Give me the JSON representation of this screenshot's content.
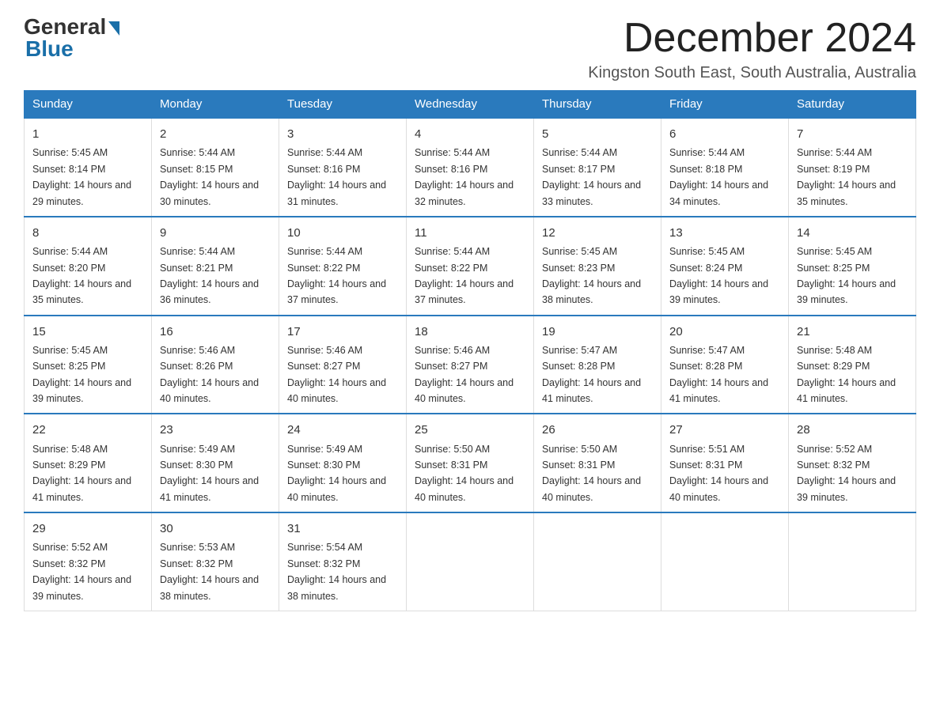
{
  "header": {
    "logo_general": "General",
    "logo_blue": "Blue",
    "month_title": "December 2024",
    "location": "Kingston South East, South Australia, Australia"
  },
  "weekdays": [
    "Sunday",
    "Monday",
    "Tuesday",
    "Wednesday",
    "Thursday",
    "Friday",
    "Saturday"
  ],
  "weeks": [
    [
      {
        "day": "1",
        "sunrise": "Sunrise: 5:45 AM",
        "sunset": "Sunset: 8:14 PM",
        "daylight": "Daylight: 14 hours and 29 minutes."
      },
      {
        "day": "2",
        "sunrise": "Sunrise: 5:44 AM",
        "sunset": "Sunset: 8:15 PM",
        "daylight": "Daylight: 14 hours and 30 minutes."
      },
      {
        "day": "3",
        "sunrise": "Sunrise: 5:44 AM",
        "sunset": "Sunset: 8:16 PM",
        "daylight": "Daylight: 14 hours and 31 minutes."
      },
      {
        "day": "4",
        "sunrise": "Sunrise: 5:44 AM",
        "sunset": "Sunset: 8:16 PM",
        "daylight": "Daylight: 14 hours and 32 minutes."
      },
      {
        "day": "5",
        "sunrise": "Sunrise: 5:44 AM",
        "sunset": "Sunset: 8:17 PM",
        "daylight": "Daylight: 14 hours and 33 minutes."
      },
      {
        "day": "6",
        "sunrise": "Sunrise: 5:44 AM",
        "sunset": "Sunset: 8:18 PM",
        "daylight": "Daylight: 14 hours and 34 minutes."
      },
      {
        "day": "7",
        "sunrise": "Sunrise: 5:44 AM",
        "sunset": "Sunset: 8:19 PM",
        "daylight": "Daylight: 14 hours and 35 minutes."
      }
    ],
    [
      {
        "day": "8",
        "sunrise": "Sunrise: 5:44 AM",
        "sunset": "Sunset: 8:20 PM",
        "daylight": "Daylight: 14 hours and 35 minutes."
      },
      {
        "day": "9",
        "sunrise": "Sunrise: 5:44 AM",
        "sunset": "Sunset: 8:21 PM",
        "daylight": "Daylight: 14 hours and 36 minutes."
      },
      {
        "day": "10",
        "sunrise": "Sunrise: 5:44 AM",
        "sunset": "Sunset: 8:22 PM",
        "daylight": "Daylight: 14 hours and 37 minutes."
      },
      {
        "day": "11",
        "sunrise": "Sunrise: 5:44 AM",
        "sunset": "Sunset: 8:22 PM",
        "daylight": "Daylight: 14 hours and 37 minutes."
      },
      {
        "day": "12",
        "sunrise": "Sunrise: 5:45 AM",
        "sunset": "Sunset: 8:23 PM",
        "daylight": "Daylight: 14 hours and 38 minutes."
      },
      {
        "day": "13",
        "sunrise": "Sunrise: 5:45 AM",
        "sunset": "Sunset: 8:24 PM",
        "daylight": "Daylight: 14 hours and 39 minutes."
      },
      {
        "day": "14",
        "sunrise": "Sunrise: 5:45 AM",
        "sunset": "Sunset: 8:25 PM",
        "daylight": "Daylight: 14 hours and 39 minutes."
      }
    ],
    [
      {
        "day": "15",
        "sunrise": "Sunrise: 5:45 AM",
        "sunset": "Sunset: 8:25 PM",
        "daylight": "Daylight: 14 hours and 39 minutes."
      },
      {
        "day": "16",
        "sunrise": "Sunrise: 5:46 AM",
        "sunset": "Sunset: 8:26 PM",
        "daylight": "Daylight: 14 hours and 40 minutes."
      },
      {
        "day": "17",
        "sunrise": "Sunrise: 5:46 AM",
        "sunset": "Sunset: 8:27 PM",
        "daylight": "Daylight: 14 hours and 40 minutes."
      },
      {
        "day": "18",
        "sunrise": "Sunrise: 5:46 AM",
        "sunset": "Sunset: 8:27 PM",
        "daylight": "Daylight: 14 hours and 40 minutes."
      },
      {
        "day": "19",
        "sunrise": "Sunrise: 5:47 AM",
        "sunset": "Sunset: 8:28 PM",
        "daylight": "Daylight: 14 hours and 41 minutes."
      },
      {
        "day": "20",
        "sunrise": "Sunrise: 5:47 AM",
        "sunset": "Sunset: 8:28 PM",
        "daylight": "Daylight: 14 hours and 41 minutes."
      },
      {
        "day": "21",
        "sunrise": "Sunrise: 5:48 AM",
        "sunset": "Sunset: 8:29 PM",
        "daylight": "Daylight: 14 hours and 41 minutes."
      }
    ],
    [
      {
        "day": "22",
        "sunrise": "Sunrise: 5:48 AM",
        "sunset": "Sunset: 8:29 PM",
        "daylight": "Daylight: 14 hours and 41 minutes."
      },
      {
        "day": "23",
        "sunrise": "Sunrise: 5:49 AM",
        "sunset": "Sunset: 8:30 PM",
        "daylight": "Daylight: 14 hours and 41 minutes."
      },
      {
        "day": "24",
        "sunrise": "Sunrise: 5:49 AM",
        "sunset": "Sunset: 8:30 PM",
        "daylight": "Daylight: 14 hours and 40 minutes."
      },
      {
        "day": "25",
        "sunrise": "Sunrise: 5:50 AM",
        "sunset": "Sunset: 8:31 PM",
        "daylight": "Daylight: 14 hours and 40 minutes."
      },
      {
        "day": "26",
        "sunrise": "Sunrise: 5:50 AM",
        "sunset": "Sunset: 8:31 PM",
        "daylight": "Daylight: 14 hours and 40 minutes."
      },
      {
        "day": "27",
        "sunrise": "Sunrise: 5:51 AM",
        "sunset": "Sunset: 8:31 PM",
        "daylight": "Daylight: 14 hours and 40 minutes."
      },
      {
        "day": "28",
        "sunrise": "Sunrise: 5:52 AM",
        "sunset": "Sunset: 8:32 PM",
        "daylight": "Daylight: 14 hours and 39 minutes."
      }
    ],
    [
      {
        "day": "29",
        "sunrise": "Sunrise: 5:52 AM",
        "sunset": "Sunset: 8:32 PM",
        "daylight": "Daylight: 14 hours and 39 minutes."
      },
      {
        "day": "30",
        "sunrise": "Sunrise: 5:53 AM",
        "sunset": "Sunset: 8:32 PM",
        "daylight": "Daylight: 14 hours and 38 minutes."
      },
      {
        "day": "31",
        "sunrise": "Sunrise: 5:54 AM",
        "sunset": "Sunset: 8:32 PM",
        "daylight": "Daylight: 14 hours and 38 minutes."
      },
      null,
      null,
      null,
      null
    ]
  ]
}
